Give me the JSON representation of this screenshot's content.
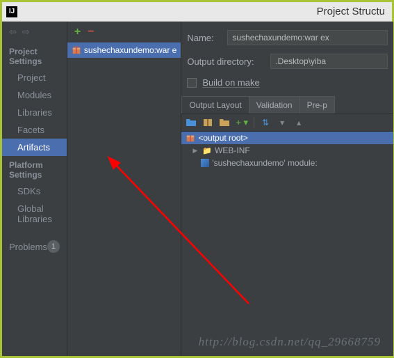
{
  "title": "Project Structu",
  "app_icon": "IJ",
  "sidebar": {
    "headings": {
      "project": "Project Settings",
      "platform": "Platform Settings"
    },
    "project_items": [
      "Project",
      "Modules",
      "Libraries",
      "Facets",
      "Artifacts"
    ],
    "platform_items": [
      "SDKs",
      "Global Libraries"
    ],
    "problems_label": "Problems",
    "problems_count": "1"
  },
  "artifacts_list": {
    "item_label": "sushechaxundemo:war e"
  },
  "form": {
    "name_label": "Name:",
    "name_value": "sushechaxundemo:war ex",
    "output_label": "Output directory:",
    "output_value": ".Desktop\\yiba",
    "build_label": "Build on make"
  },
  "tabs": [
    "Output Layout",
    "Validation",
    "Pre-p"
  ],
  "tree": {
    "root": "<output root>",
    "webinf": "WEB-INF",
    "module": "'sushechaxundemo' module:"
  },
  "watermark": "http://blog.csdn.net/qq_29668759"
}
